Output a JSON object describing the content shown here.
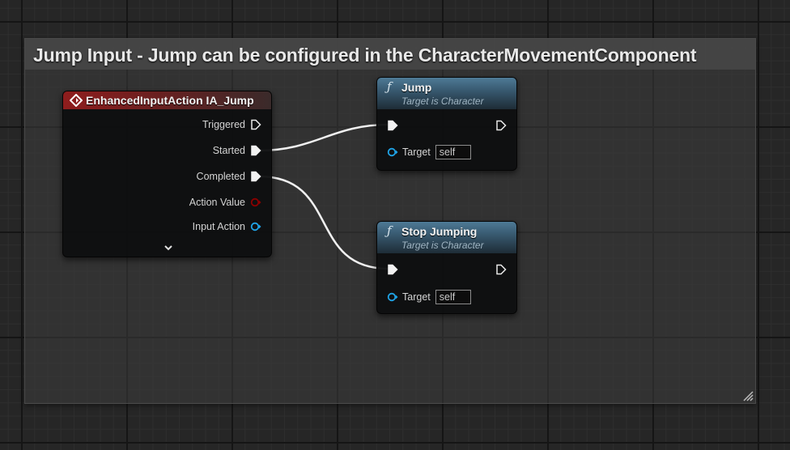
{
  "comment": {
    "title": "Jump Input - Jump can be configured in the CharacterMovementComponent"
  },
  "event_node": {
    "icon": "event-diamond-icon",
    "title": "EnhancedInputAction IA_Jump",
    "outputs": [
      {
        "label": "Triggered",
        "type": "exec",
        "connected": false
      },
      {
        "label": "Started",
        "type": "exec",
        "connected": true
      },
      {
        "label": "Completed",
        "type": "exec",
        "connected": true
      },
      {
        "label": "Action Value",
        "type": "bool",
        "color": "#8c0000"
      },
      {
        "label": "Input Action",
        "type": "object",
        "color": "#1fa3e6"
      }
    ],
    "expand_icon": "chevron-down-icon"
  },
  "jump_node": {
    "icon": "function-icon",
    "title": "Jump",
    "subtitle": "Target is Character",
    "target_label": "Target",
    "target_value": "self"
  },
  "stop_node": {
    "icon": "function-icon",
    "title": "Stop Jumping",
    "subtitle": "Target is Character",
    "target_label": "Target",
    "target_value": "self"
  },
  "colors": {
    "event_header": "#8f1d1d",
    "function_header": "#4e7a96",
    "exec_wire": "#ffffff",
    "bool_pin": "#8c0000",
    "object_pin": "#1fa3e6"
  }
}
